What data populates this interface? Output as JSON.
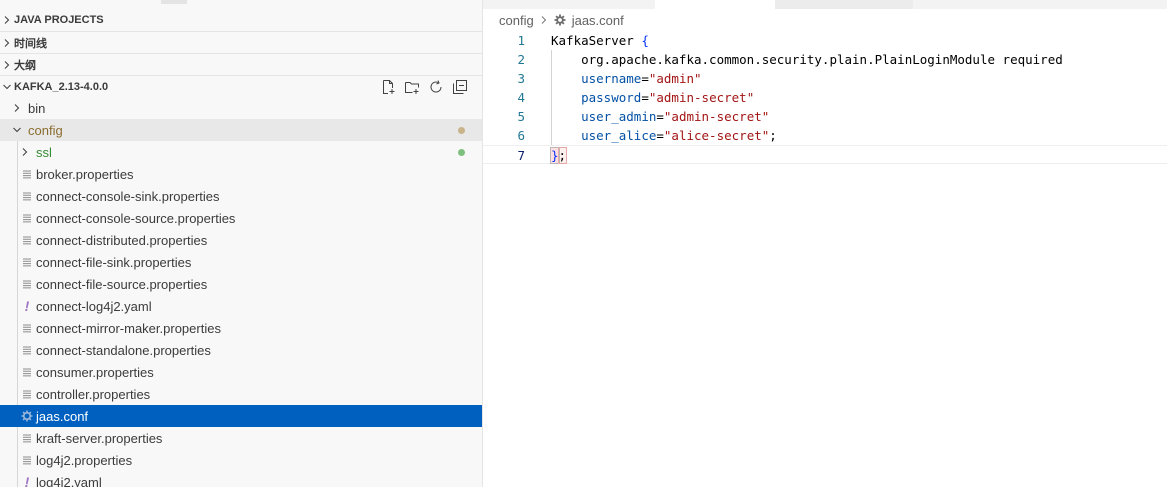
{
  "sidebar": {
    "sections": [
      {
        "label": "JAVA PROJECTS",
        "expanded": false
      },
      {
        "label": "时间线",
        "expanded": false
      },
      {
        "label": "大纲",
        "expanded": false
      },
      {
        "label": "KAFKA_2.13-4.0.0",
        "expanded": true
      }
    ],
    "section_actions": [
      "new-file-icon",
      "new-folder-icon",
      "refresh-icon",
      "collapse-all-icon"
    ],
    "tree": [
      {
        "name": "bin",
        "type": "folder",
        "expanded": false
      },
      {
        "name": "config",
        "type": "folder",
        "expanded": true,
        "status_color": "#c9b38a"
      },
      {
        "name": "ssl",
        "type": "folder",
        "expanded": false,
        "status_color": "#7fbf7f"
      },
      {
        "name": "broker.properties",
        "type": "file",
        "icon": "lines-icon"
      },
      {
        "name": "connect-console-sink.properties",
        "type": "file",
        "icon": "lines-icon"
      },
      {
        "name": "connect-console-source.properties",
        "type": "file",
        "icon": "lines-icon"
      },
      {
        "name": "connect-distributed.properties",
        "type": "file",
        "icon": "lines-icon"
      },
      {
        "name": "connect-file-sink.properties",
        "type": "file",
        "icon": "lines-icon"
      },
      {
        "name": "connect-file-source.properties",
        "type": "file",
        "icon": "lines-icon"
      },
      {
        "name": "connect-log4j2.yaml",
        "type": "file",
        "icon": "yaml-icon"
      },
      {
        "name": "connect-mirror-maker.properties",
        "type": "file",
        "icon": "lines-icon"
      },
      {
        "name": "connect-standalone.properties",
        "type": "file",
        "icon": "lines-icon"
      },
      {
        "name": "consumer.properties",
        "type": "file",
        "icon": "lines-icon"
      },
      {
        "name": "controller.properties",
        "type": "file",
        "icon": "lines-icon"
      },
      {
        "name": "jaas.conf",
        "type": "file",
        "icon": "gear-icon",
        "selected": true
      },
      {
        "name": "kraft-server.properties",
        "type": "file",
        "icon": "lines-icon"
      },
      {
        "name": "log4j2.properties",
        "type": "file",
        "icon": "lines-icon"
      },
      {
        "name": "log4j2.yaml",
        "type": "file",
        "icon": "yaml-icon"
      }
    ]
  },
  "editor": {
    "breadcrumb": {
      "folder": "config",
      "file": "jaas.conf"
    },
    "current_line": 7,
    "lines": [
      {
        "num": "1",
        "tokens": [
          {
            "t": "KafkaServer ",
            "c": "plain"
          },
          {
            "t": "{",
            "c": "brace"
          }
        ]
      },
      {
        "num": "2",
        "tokens": [
          {
            "t": "    org.apache.kafka.common.security.plain.PlainLoginModule required",
            "c": "plain"
          }
        ]
      },
      {
        "num": "3",
        "tokens": [
          {
            "t": "    ",
            "c": "plain"
          },
          {
            "t": "username",
            "c": "key"
          },
          {
            "t": "=",
            "c": "op"
          },
          {
            "t": "\"admin\"",
            "c": "str"
          }
        ]
      },
      {
        "num": "4",
        "tokens": [
          {
            "t": "    ",
            "c": "plain"
          },
          {
            "t": "password",
            "c": "key"
          },
          {
            "t": "=",
            "c": "op"
          },
          {
            "t": "\"admin-secret\"",
            "c": "str"
          }
        ]
      },
      {
        "num": "5",
        "tokens": [
          {
            "t": "    ",
            "c": "plain"
          },
          {
            "t": "user_admin",
            "c": "key"
          },
          {
            "t": "=",
            "c": "op"
          },
          {
            "t": "\"admin-secret\"",
            "c": "str"
          }
        ]
      },
      {
        "num": "6",
        "tokens": [
          {
            "t": "    ",
            "c": "plain"
          },
          {
            "t": "user_alice",
            "c": "key"
          },
          {
            "t": "=",
            "c": "op"
          },
          {
            "t": "\"alice-secret\"",
            "c": "str"
          },
          {
            "t": ";",
            "c": "plain"
          }
        ]
      },
      {
        "num": "7",
        "tokens": [
          {
            "t": "}",
            "c": "brace-match"
          },
          {
            "t": ";",
            "c": "semi-match"
          }
        ]
      }
    ]
  },
  "colors": {
    "selection": "#0060c0",
    "active_parent": "#e8e8e8",
    "modified_dot": "#c9b38a",
    "untracked_dot": "#7fbf7f",
    "string": "#a31515",
    "key": "#0451a5",
    "line_number": "#237893"
  }
}
